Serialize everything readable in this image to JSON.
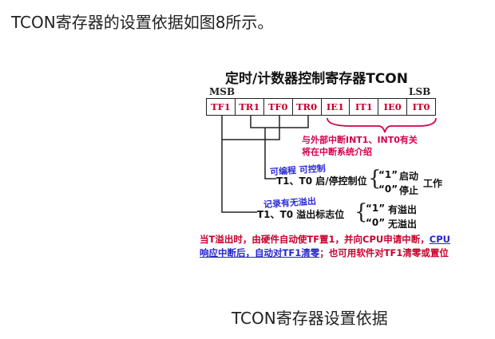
{
  "intro_text": "TCON寄存器的设置依据如图8所示。",
  "figure": {
    "title": "定时/计数器控制寄存器TCON",
    "msb_label": "MSB",
    "lsb_label": "LSB",
    "bits": [
      "TF1",
      "TR1",
      "TF0",
      "TR0",
      "IE1",
      "IT1",
      "IE0",
      "IT0"
    ],
    "bit_color": "#c4002b",
    "external_interrupt_note_line1": "与外部中断INT1、INT0有关",
    "external_interrupt_note_line2": "将在中断系统介绍",
    "tr_annotation": "可编程 可控制",
    "tf_annotation": "记录有无溢出",
    "tr_row": {
      "label": "T1、T0 启/停控制位",
      "option1_value": "“1”",
      "option1_text": "启动",
      "option2_value": "“0”",
      "option2_text": "停止",
      "suffix": "工作"
    },
    "tf_row": {
      "label": "T1、T0 溢出标志位",
      "option1_value": "“1”",
      "option1_text": "有溢出",
      "option2_value": "“0”",
      "option2_text": "无溢出"
    },
    "bottom_note": {
      "part1": "当T溢出时，由硬件自动使TF置1，并向CPU申请中断，",
      "part2": "CPU响应中断后，自动对TF1清零",
      "part3": "；也可用软件对TF1清零或置位"
    }
  },
  "caption": "TCON寄存器设置依据"
}
